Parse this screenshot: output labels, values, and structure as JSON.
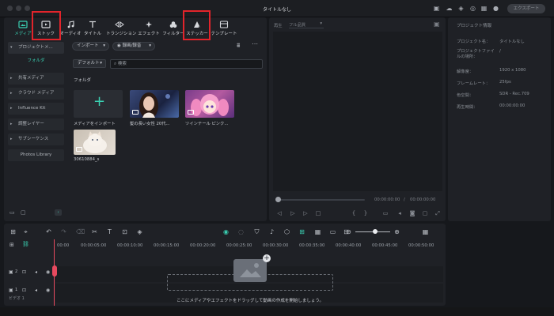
{
  "window": {
    "title": "タイトルなし",
    "export_label": "エクスポート"
  },
  "colors": {
    "accent": "#3ad0b2",
    "highlight": "#e2242b",
    "playhead": "#e84a5f"
  },
  "toolbar": {
    "tabs": [
      {
        "label": "メディア",
        "icon": "media-icon"
      },
      {
        "label": "ストック",
        "icon": "stock-icon"
      },
      {
        "label": "オーディオ",
        "icon": "music-note-icon"
      },
      {
        "label": "タイトル",
        "icon": "title-t-icon"
      },
      {
        "label": "トランジション",
        "icon": "transition-icon"
      },
      {
        "label": "エフェクト",
        "icon": "effect-icon"
      },
      {
        "label": "フィルター",
        "icon": "filter-icon"
      },
      {
        "label": "ステッカー",
        "icon": "sticker-icon"
      },
      {
        "label": "テンプレート",
        "icon": "template-icon"
      }
    ]
  },
  "sidebar": {
    "items": [
      {
        "label": "プロジェクトメ..."
      },
      {
        "label": "共有メディア"
      },
      {
        "label": "クラウド メディア"
      },
      {
        "label": "Influence Kit"
      },
      {
        "label": "調整レイヤー"
      },
      {
        "label": "サブシーケンス"
      },
      {
        "label": "Photos Library"
      }
    ],
    "selected": "フォルダ"
  },
  "media": {
    "import_label": "インポート",
    "record_label": "録画/録音",
    "sort_label": "デフォルト",
    "search_placeholder": "検索",
    "folder_label": "フォルダ",
    "items": [
      {
        "caption": "メディアをインポート"
      },
      {
        "caption": "髪の長い女性  20代..."
      },
      {
        "caption": "ツインテール  ピンク..."
      },
      {
        "caption": "30610884_s"
      }
    ]
  },
  "preview": {
    "label": "再生",
    "quality": "フル品質",
    "time_current": "00:00:00:00",
    "time_total": "00:00:00:00"
  },
  "info": {
    "title": "プロジェクト情報",
    "rows": [
      {
        "key": "プロジェクト名：",
        "value": "タイトルなし"
      },
      {
        "key": "プロジェクトファイルの場所：",
        "value": "/"
      },
      {
        "key": "解像度：",
        "value": "1920 x 1080"
      },
      {
        "key": "フレームレート：",
        "value": "25fps"
      },
      {
        "key": "色空間：",
        "value": "SDR - Rec.709"
      },
      {
        "key": "再生時間：",
        "value": "00:00:00:00"
      }
    ]
  },
  "timeline": {
    "ticks": [
      "00:00",
      "00:00:05:00",
      "00:00:10:00",
      "00:00:15:00",
      "00:00:20:00",
      "00:00:25:00",
      "00:00:30:00",
      "00:00:35:00",
      "00:00:40:00",
      "00:00:45:00",
      "00:00:50:00"
    ],
    "tracks": [
      {
        "label": "2"
      },
      {
        "label": "1",
        "name": "ビデオ 1"
      }
    ],
    "drop_hint": "ここにメディアやエフェクトをドラッグして動画の作成を開始しましょう。"
  }
}
